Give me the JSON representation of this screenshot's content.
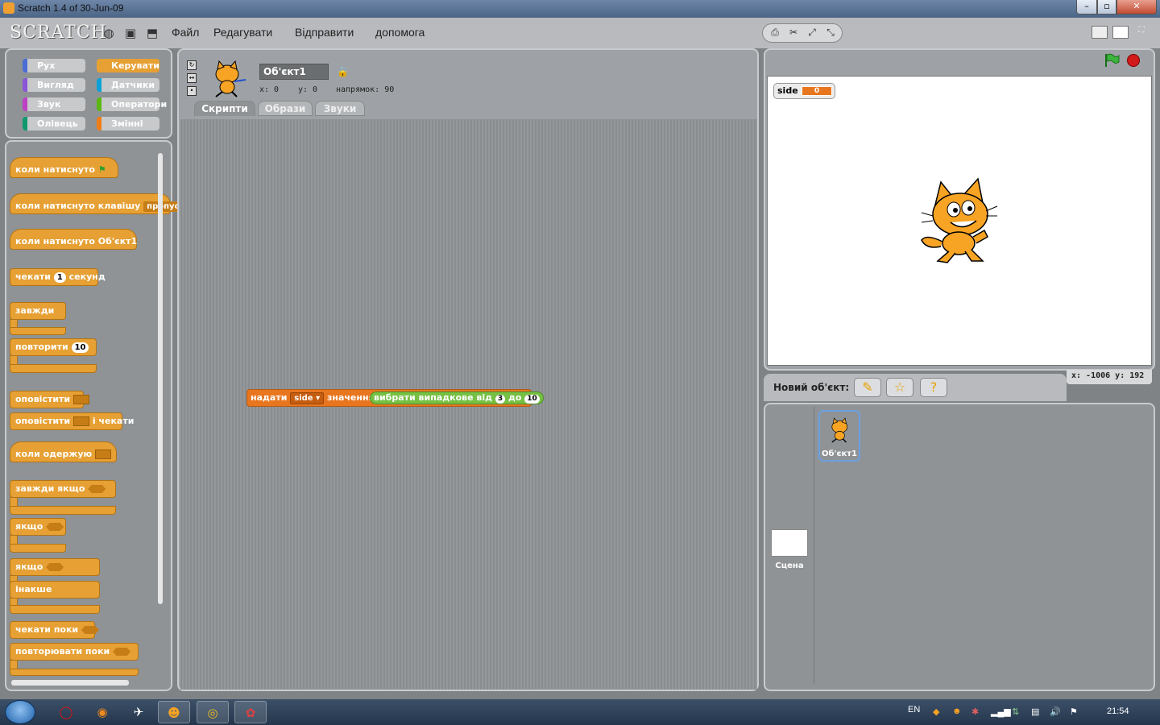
{
  "window": {
    "title": "Scratch 1.4 of 30-Jun-09"
  },
  "menu": {
    "logo": "SCRATCH",
    "items": [
      "Файл",
      "Редагувати",
      "Відправити",
      "допомога"
    ]
  },
  "categories": [
    {
      "label": "Рух",
      "color": "#4a6cd4"
    },
    {
      "label": "Керувати",
      "color": "#e6a033"
    },
    {
      "label": "Вигляд",
      "color": "#8a55d7"
    },
    {
      "label": "Датчики",
      "color": "#0aa1d8"
    },
    {
      "label": "Звук",
      "color": "#bb42c3"
    },
    {
      "label": "Оператори",
      "color": "#5cb712"
    },
    {
      "label": "Олівець",
      "color": "#0e9a6c"
    },
    {
      "label": "Змінні",
      "color": "#ee7d16"
    }
  ],
  "palette": {
    "when_flag": "коли натиснуто",
    "when_key": "коли натиснуто клавішу",
    "key_value": "пропуск",
    "when_sprite": "коли натиснуто  Об'єкт1",
    "wait": "чекати",
    "wait_num": "1",
    "wait_unit": "секунд",
    "forever": "завжди",
    "repeat": "повторити",
    "repeat_num": "10",
    "broadcast": "оповістити",
    "broadcast_wait": "оповістити",
    "broadcast_wait_tail": "і чекати",
    "when_receive": "коли одержую",
    "forever_if": "завжди якщо",
    "if": "якщо",
    "if_else": "якщо",
    "else": "інакше",
    "wait_until": "чекати поки",
    "repeat_until": "повторювати поки"
  },
  "sprite": {
    "name": "Об'єкт1",
    "x_label": "x: 0",
    "y_label": "y: 0",
    "dir_label": "напрямок: 90"
  },
  "tabs": [
    "Скрипти",
    "Образи",
    "Звуки"
  ],
  "script": {
    "set": "надати",
    "var": "side",
    "to": "значення",
    "pick": "вибрати випадкове від",
    "from": "3",
    "and": "до",
    "upto": "10"
  },
  "stage": {
    "monitor_name": "side",
    "monitor_value": "0",
    "mouse_xy": "x: -1006  y: 192"
  },
  "new_sprite": {
    "label": "Новий об'єкт:"
  },
  "sprites_list": {
    "sprite": "Об'єкт1",
    "stage": "Сцена"
  },
  "taskbar": {
    "lang": "EN",
    "time": "21:54"
  }
}
